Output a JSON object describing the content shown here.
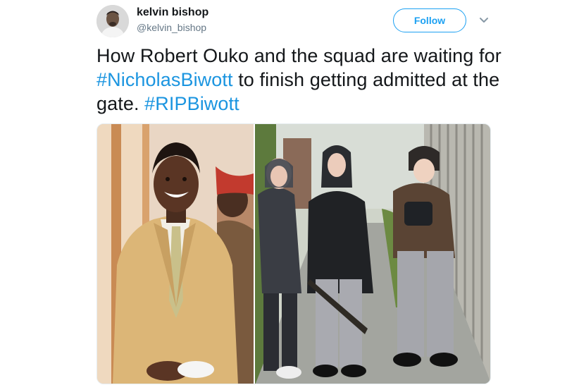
{
  "user": {
    "display_name": "kelvin bishop",
    "handle": "@kelvin_bishop",
    "avatar_icon": "user-avatar"
  },
  "actions": {
    "follow_label": "Follow",
    "more_icon": "chevron-down-icon"
  },
  "tweet": {
    "text_part1": "How Robert Ouko and the squad are waiting for ",
    "hashtag1": "#NicholasBiwott",
    "text_part2": " to finish getting admitted at the gate. ",
    "hashtag2": "#RIPBiwott"
  },
  "colors": {
    "accent": "#1da1f2",
    "hashtag": "#1b95e0",
    "text": "#14171a",
    "secondary": "#657786"
  }
}
